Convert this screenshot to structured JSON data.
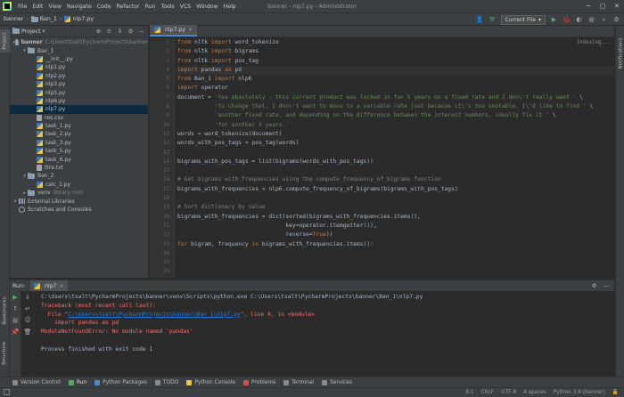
{
  "titlebar": {
    "menu": [
      "File",
      "Edit",
      "View",
      "Navigate",
      "Code",
      "Refactor",
      "Run",
      "Tools",
      "VCS",
      "Window",
      "Help"
    ],
    "window_title": "banner - nlp7.py - Administrator"
  },
  "navbar": {
    "crumbs": [
      "banner",
      "Ban_1",
      "nlp7.py"
    ],
    "run_config": "Current File"
  },
  "project": {
    "header": "Project",
    "tree": [
      {
        "name": "banner",
        "sub": "C:\\Users\\tsalt\\PycharmProjects\\banner",
        "type": "folder",
        "indent": 0,
        "arrow": "▾"
      },
      {
        "name": "Ban_1",
        "sub": "",
        "type": "folder",
        "indent": 1,
        "arrow": "▾"
      },
      {
        "name": "__init__.py",
        "sub": "",
        "type": "py",
        "indent": 2,
        "arrow": ""
      },
      {
        "name": "nlp1.py",
        "sub": "",
        "type": "py",
        "indent": 2,
        "arrow": ""
      },
      {
        "name": "nlp2.py",
        "sub": "",
        "type": "py",
        "indent": 2,
        "arrow": ""
      },
      {
        "name": "nlp3.py",
        "sub": "",
        "type": "py",
        "indent": 2,
        "arrow": ""
      },
      {
        "name": "nlp5.py",
        "sub": "",
        "type": "py",
        "indent": 2,
        "arrow": ""
      },
      {
        "name": "nlp6.py",
        "sub": "",
        "type": "py",
        "indent": 2,
        "arrow": ""
      },
      {
        "name": "nlp7.py",
        "sub": "",
        "type": "py",
        "indent": 2,
        "arrow": "",
        "selected": true
      },
      {
        "name": "res.csv",
        "sub": "",
        "type": "csv",
        "indent": 2,
        "arrow": ""
      },
      {
        "name": "task_1.py",
        "sub": "",
        "type": "py",
        "indent": 2,
        "arrow": ""
      },
      {
        "name": "task_2.py",
        "sub": "",
        "type": "py",
        "indent": 2,
        "arrow": ""
      },
      {
        "name": "task_3.py",
        "sub": "",
        "type": "py",
        "indent": 2,
        "arrow": ""
      },
      {
        "name": "task_5.py",
        "sub": "",
        "type": "py",
        "indent": 2,
        "arrow": ""
      },
      {
        "name": "task_6.py",
        "sub": "",
        "type": "py",
        "indent": 2,
        "arrow": ""
      },
      {
        "name": "ttra.txt",
        "sub": "",
        "type": "txt",
        "indent": 2,
        "arrow": ""
      },
      {
        "name": "Ban_2",
        "sub": "",
        "type": "folder",
        "indent": 1,
        "arrow": "▾"
      },
      {
        "name": "calc_1.py",
        "sub": "",
        "type": "py",
        "indent": 2,
        "arrow": ""
      },
      {
        "name": "venv",
        "sub": "library root",
        "type": "folder",
        "indent": 1,
        "arrow": "▸"
      },
      {
        "name": "External Libraries",
        "sub": "",
        "type": "lib",
        "indent": 0,
        "arrow": "▸"
      },
      {
        "name": "Scratches and Consoles",
        "sub": "",
        "type": "scratch",
        "indent": 0,
        "arrow": ""
      }
    ]
  },
  "editor": {
    "tab": "nlp7.py",
    "indexing": "Indexing...",
    "line_numbers": [
      "1",
      "2",
      "3",
      "4",
      "5",
      "6",
      "7",
      "8",
      "9",
      "10",
      "11",
      "12",
      "13",
      "14",
      "15",
      "16",
      "17",
      "18",
      "19",
      "20",
      "21",
      "22",
      "23",
      "24",
      "25",
      "26"
    ],
    "code_html": [
      "<span class='kw'>from</span> nltk <span class='kw'>import</span> word_tokenize",
      "<span class='kw'>from</span> nltk <span class='kw'>import</span> bigrams",
      "<span class='kw'>from</span> nltk <span class='kw'>import</span> pos_tag",
      "<span class='kw'>import</span> pandas <span class='kw'>as</span> pd",
      "<span class='kw'>from</span> Ban_1 <span class='kw'>import</span> nlp6",
      "<span class='kw'>import</span> operator",
      "document = <span class='str'>'Yes absolutely - this current product was locked in for 5 years on a fixed rate and I don\\'t really want '</span> \\",
      "           <span class='str'>'to change that, I don\\'t want to move to a variable rate just because it\\'s too unstable. I\\'d like to find '</span> \\",
      "           <span class='str'>'another fixed rate, and depending on the difference between the interest numbers, ideally fix it '</span> \\",
      "           <span class='str'>'for another 5 years.'</span>",
      "words = word_tokenize(document)",
      "words_with_pos_tags = pos_tag(words)",
      "",
      "bigrams_with_pos_tags = list(bigrams(words_with_pos_tags))",
      "",
      "<span class='cmt'># Get bigrams with frequencies using the compute_frequency_of_bigrams function</span>",
      "bigrams_with_frequencies = nlp6.compute_frequency_of_bigrams(bigrams_with_pos_tags)",
      "",
      "<span class='cmt'># Sort dictionary by value</span>",
      "bigrams_with_frequencies = dict(sorted(bigrams_with_frequencies.items(),",
      "                                key=operator.itemgetter(<span class='num'>1</span>),",
      "                                reverse=<span class='kw'>True</span>))",
      "<span class='kw'>for</span> bigram, frequency <span class='kw'>in</span> bigrams_with_frequencies.items():"
    ]
  },
  "run": {
    "label": "Run:",
    "tab": "nlp7",
    "console": [
      {
        "text": "C:\\Users\\tsalt\\PycharmProjects\\banner\\venv\\Scripts\\python.exe C:\\Users\\tsalt\\PycharmProjects\\banner\\Ban_1\\nlp7.py",
        "kind": "normal"
      },
      {
        "text": "Traceback (most recent call last):",
        "kind": "err"
      },
      {
        "text": "  File \"",
        "kind": "err-link",
        "link": "C:\\Users\\tsalt\\PycharmProjects\\banner\\Ban_1\\nlp7.py",
        "after": "\", line 4, in <module>"
      },
      {
        "text": "    import pandas as pd",
        "kind": "err"
      },
      {
        "text": "ModuleNotFoundError: No module named 'pandas'",
        "kind": "err"
      },
      {
        "text": "",
        "kind": "normal"
      },
      {
        "text": "Process finished with exit code 1",
        "kind": "normal"
      }
    ]
  },
  "bottom_tabs": [
    {
      "label": "Version Control",
      "color": "#8a8a8a",
      "active": false
    },
    {
      "label": "Run",
      "color": "#59a869",
      "active": true
    },
    {
      "label": "Python Packages",
      "color": "#4a88c7",
      "active": false
    },
    {
      "label": "TODO",
      "color": "#8a8a8a",
      "active": false
    },
    {
      "label": "Python Console",
      "color": "#f0c33c",
      "active": false
    },
    {
      "label": "Problems",
      "color": "#c75450",
      "active": false
    },
    {
      "label": "Terminal",
      "color": "#8a8a8a",
      "active": false
    },
    {
      "label": "Services",
      "color": "#8a8a8a",
      "active": false
    }
  ],
  "status_bar": {
    "position": "8:1",
    "line_sep": "CRLF",
    "encoding": "UTF-8",
    "indent": "4 spaces",
    "interpreter": "Python 3.9 (banner)"
  },
  "side_tabs": {
    "project": "Project",
    "bookmarks": "Bookmarks",
    "structure": "Structure",
    "notifications": "Notifications"
  }
}
